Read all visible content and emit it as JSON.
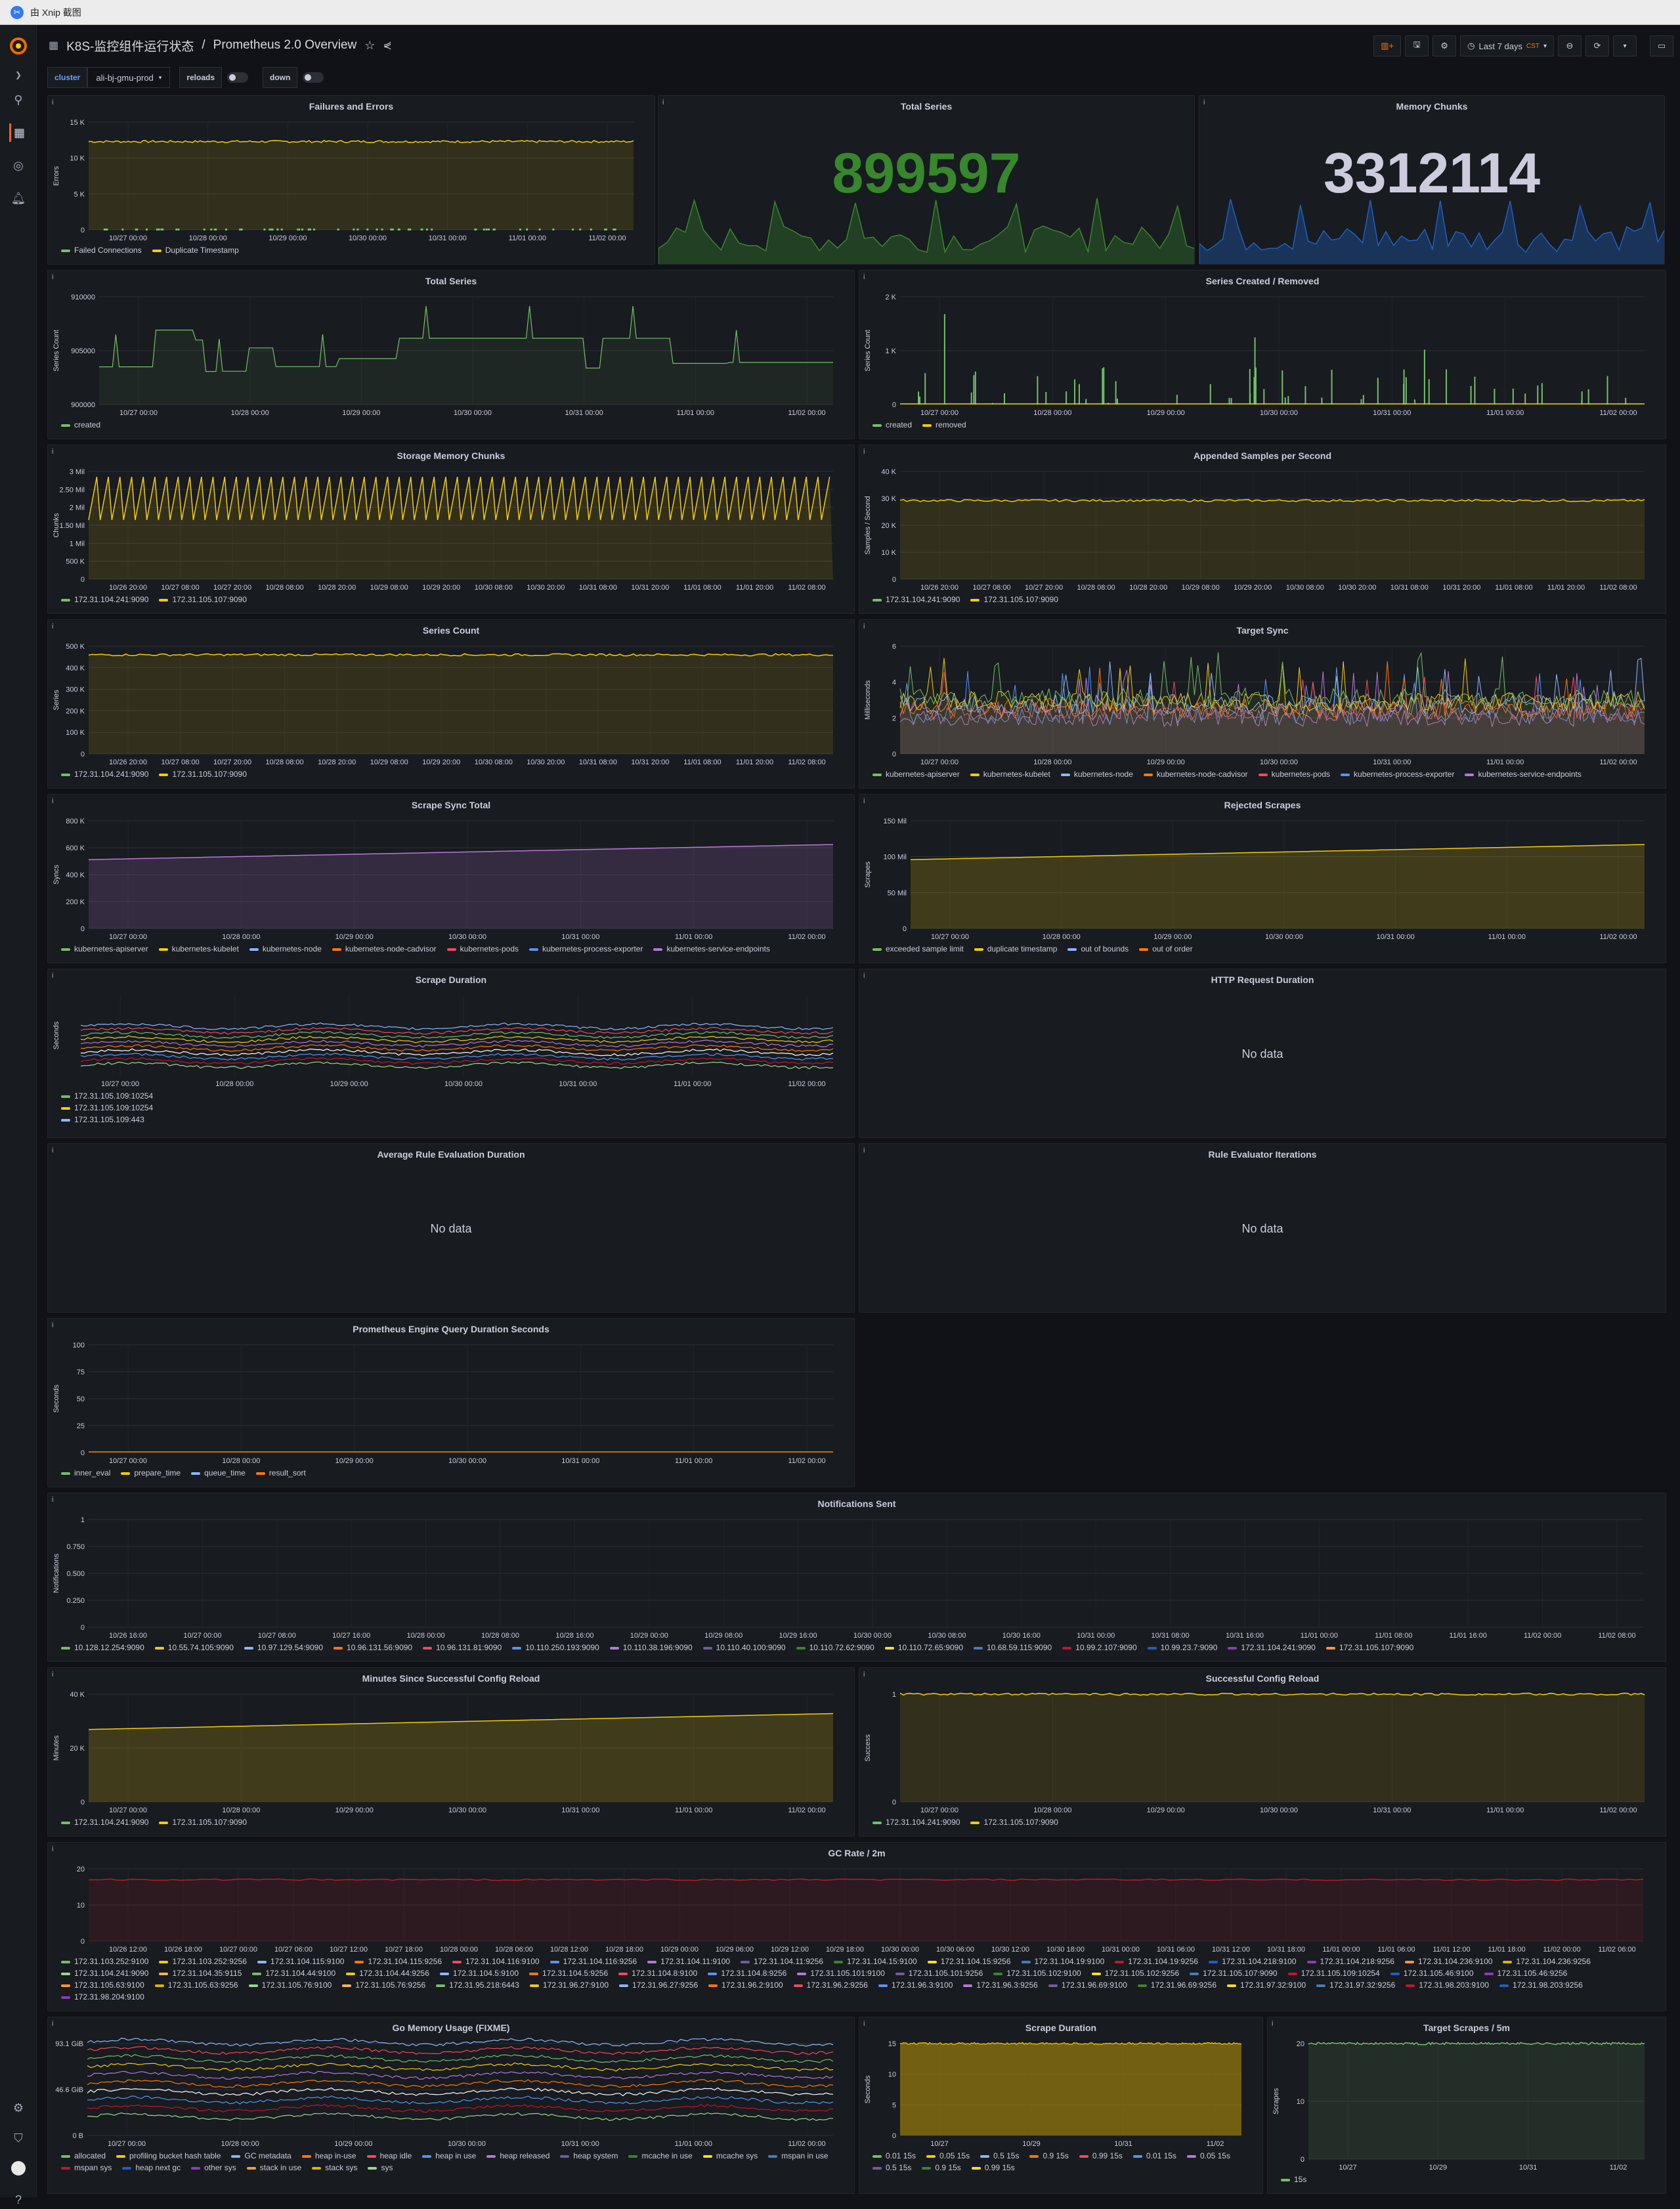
{
  "window": {
    "title": "由 Xnip 截图"
  },
  "header": {
    "folder": "K8S-监控组件运行状态",
    "separator": "/",
    "dashboard": "Prometheus 2.0 Overview",
    "time_range": "Last 7 days",
    "timezone": "CST"
  },
  "variables": [
    {
      "label": "cluster",
      "value": "ali-bj-gmu-prod",
      "type": "select"
    },
    {
      "label": "reloads",
      "type": "toggle"
    },
    {
      "label": "down",
      "type": "toggle"
    }
  ],
  "panels": {
    "failures": {
      "title": "Failures and Errors",
      "ylabel": "Errors",
      "yticks": [
        "15 K",
        "10 K",
        "5 K",
        "0"
      ],
      "xticks": [
        "10/27 00:00",
        "10/28 00:00",
        "10/29 00:00",
        "10/30 00:00",
        "10/31 00:00",
        "11/01 00:00",
        "11/02 00:00"
      ],
      "legend": [
        "Failed Connections",
        "Duplicate Timestamp"
      ]
    },
    "total_series_stat": {
      "title": "Total Series",
      "value": "899597",
      "color": "#37872d"
    },
    "memory_chunks_stat": {
      "title": "Memory Chunks",
      "value": "3312114",
      "color": "#ccccdc"
    },
    "total_series": {
      "title": "Total Series",
      "ylabel": "Series Count",
      "yticks": [
        "910000",
        "905000",
        "900000"
      ],
      "xticks": [
        "10/27 00:00",
        "10/28 00:00",
        "10/29 00:00",
        "10/30 00:00",
        "10/31 00:00",
        "11/01 00:00",
        "11/02 00:00"
      ],
      "legend": [
        "created"
      ]
    },
    "series_created": {
      "title": "Series Created / Removed",
      "ylabel": "Series Count",
      "yticks": [
        "2 K",
        "1 K",
        "0"
      ],
      "xticks": [
        "10/27 00:00",
        "10/28 00:00",
        "10/29 00:00",
        "10/30 00:00",
        "10/31 00:00",
        "11/01 00:00",
        "11/02 00:00"
      ],
      "legend": [
        "created",
        "removed"
      ]
    },
    "storage_chunks": {
      "title": "Storage Memory Chunks",
      "ylabel": "Chunks",
      "yticks": [
        "3 Mil",
        "2.50 Mil",
        "2 Mil",
        "1.50 Mil",
        "1 Mil",
        "500 K",
        "0"
      ],
      "xticks": [
        "10/26 20:00",
        "10/27 08:00",
        "10/27 20:00",
        "10/28 08:00",
        "10/28 20:00",
        "10/29 08:00",
        "10/29 20:00",
        "10/30 08:00",
        "10/30 20:00",
        "10/31 08:00",
        "10/31 20:00",
        "11/01 08:00",
        "11/01 20:00",
        "11/02 08:00"
      ],
      "legend": [
        "172.31.104.241:9090",
        "172.31.105.107:9090"
      ]
    },
    "appended": {
      "title": "Appended Samples per Second",
      "ylabel": "Samples / Second",
      "yticks": [
        "40 K",
        "30 K",
        "20 K",
        "10 K",
        "0"
      ],
      "xticks": [
        "10/26 20:00",
        "10/27 08:00",
        "10/27 20:00",
        "10/28 08:00",
        "10/28 20:00",
        "10/29 08:00",
        "10/29 20:00",
        "10/30 08:00",
        "10/30 20:00",
        "10/31 08:00",
        "10/31 20:00",
        "11/01 08:00",
        "11/01 20:00",
        "11/02 08:00"
      ],
      "legend": [
        "172.31.104.241:9090",
        "172.31.105.107:9090"
      ]
    },
    "series_count": {
      "title": "Series Count",
      "ylabel": "Series",
      "yticks": [
        "500 K",
        "400 K",
        "300 K",
        "200 K",
        "100 K",
        "0"
      ],
      "xticks": [
        "10/26 20:00",
        "10/27 08:00",
        "10/27 20:00",
        "10/28 08:00",
        "10/28 20:00",
        "10/29 08:00",
        "10/29 20:00",
        "10/30 08:00",
        "10/30 20:00",
        "10/31 08:00",
        "10/31 20:00",
        "11/01 08:00",
        "11/01 20:00",
        "11/02 08:00"
      ],
      "legend": [
        "172.31.104.241:9090",
        "172.31.105.107:9090"
      ]
    },
    "target_sync": {
      "title": "Target Sync",
      "ylabel": "Milliseconds",
      "yticks": [
        "6",
        "4",
        "2",
        "0"
      ],
      "xticks": [
        "10/27 00:00",
        "10/28 00:00",
        "10/29 00:00",
        "10/30 00:00",
        "10/31 00:00",
        "11/01 00:00",
        "11/02 00:00"
      ],
      "legend": [
        "kubernetes-apiserver",
        "kubernetes-kubelet",
        "kubernetes-node",
        "kubernetes-node-cadvisor",
        "kubernetes-pods",
        "kubernetes-process-exporter",
        "kubernetes-service-endpoints"
      ]
    },
    "scrape_sync": {
      "title": "Scrape Sync Total",
      "ylabel": "Syncs",
      "yticks": [
        "800 K",
        "600 K",
        "400 K",
        "200 K",
        "0"
      ],
      "xticks": [
        "10/27 00:00",
        "10/28 00:00",
        "10/29 00:00",
        "10/30 00:00",
        "10/31 00:00",
        "11/01 00:00",
        "11/02 00:00"
      ],
      "legend": [
        "kubernetes-apiserver",
        "kubernetes-kubelet",
        "kubernetes-node",
        "kubernetes-node-cadvisor",
        "kubernetes-pods",
        "kubernetes-process-exporter",
        "kubernetes-service-endpoints"
      ]
    },
    "rejected": {
      "title": "Rejected Scrapes",
      "ylabel": "Scrapes",
      "yticks": [
        "150 Mil",
        "100 Mil",
        "50 Mil",
        "0"
      ],
      "xticks": [
        "10/27 00:00",
        "10/28 00:00",
        "10/29 00:00",
        "10/30 00:00",
        "10/31 00:00",
        "11/01 00:00",
        "11/02 00:00"
      ],
      "legend": [
        "exceeded sample limit",
        "duplicate timestamp",
        "out of bounds",
        "out of order"
      ]
    },
    "scrape_duration": {
      "title": "Scrape Duration",
      "ylabel": "Seconds",
      "xticks": [
        "10/27 00:00",
        "10/28 00:00",
        "10/29 00:00",
        "10/30 00:00",
        "10/31 00:00",
        "11/01 00:00",
        "11/02 00:00"
      ],
      "legend": [
        "172.31.105.109:10254",
        "172.31.105.109:10254",
        "172.31.105.109:443"
      ]
    },
    "http_duration": {
      "title": "HTTP Request Duration",
      "nodata": "No data"
    },
    "avg_rule": {
      "title": "Average Rule Evaluation Duration",
      "nodata": "No data"
    },
    "rule_iter": {
      "title": "Rule Evaluator Iterations",
      "nodata": "No data"
    },
    "engine_query": {
      "title": "Prometheus Engine Query Duration Seconds",
      "ylabel": "Seconds",
      "yticks": [
        "100",
        "75",
        "50",
        "25",
        "0"
      ],
      "xticks": [
        "10/27 00:00",
        "10/28 00:00",
        "10/29 00:00",
        "10/30 00:00",
        "10/31 00:00",
        "11/01 00:00",
        "11/02 00:00"
      ],
      "legend": [
        "inner_eval",
        "prepare_time",
        "queue_time",
        "result_sort"
      ]
    },
    "notifications": {
      "title": "Notifications Sent",
      "ylabel": "Notifications",
      "yticks": [
        "1",
        "0.750",
        "0.500",
        "0.250",
        "0"
      ],
      "xticks": [
        "10/26 16:00",
        "10/27 00:00",
        "10/27 08:00",
        "10/27 16:00",
        "10/28 00:00",
        "10/28 08:00",
        "10/28 16:00",
        "10/29 00:00",
        "10/29 08:00",
        "10/29 16:00",
        "10/30 00:00",
        "10/30 08:00",
        "10/30 16:00",
        "10/31 00:00",
        "10/31 08:00",
        "10/31 16:00",
        "11/01 00:00",
        "11/01 08:00",
        "11/01 16:00",
        "11/02 00:00",
        "11/02 08:00"
      ],
      "legend": [
        "10.128.12.254:9090",
        "10.55.74.105:9090",
        "10.97.129.54:9090",
        "10.96.131.56:9090",
        "10.96.131.81:9090",
        "10.110.250.193:9090",
        "10.110.38.196:9090",
        "10.110.40.100:9090",
        "10.110.72.62:9090",
        "10.110.72.65:9090",
        "10.68.59.115:9090",
        "10.99.2.107:9090",
        "10.99.23.7:9090",
        "172.31.104.241:9090",
        "172.31.105.107:9090"
      ]
    },
    "minutes_reload": {
      "title": "Minutes Since Successful Config Reload",
      "ylabel": "Minutes",
      "yticks": [
        "40 K",
        "20 K",
        "0"
      ],
      "xticks": [
        "10/27 00:00",
        "10/28 00:00",
        "10/29 00:00",
        "10/30 00:00",
        "10/31 00:00",
        "11/01 00:00",
        "11/02 00:00"
      ],
      "legend": [
        "172.31.104.241:9090",
        "172.31.105.107:9090"
      ]
    },
    "success_reload": {
      "title": "Successful Config Reload",
      "ylabel": "Success",
      "yticks": [
        "1",
        "0"
      ],
      "xticks": [
        "10/27 00:00",
        "10/28 00:00",
        "10/29 00:00",
        "10/30 00:00",
        "10/31 00:00",
        "11/01 00:00",
        "11/02 00:00"
      ],
      "legend": [
        "172.31.104.241:9090",
        "172.31.105.107:9090"
      ]
    },
    "gc_rate": {
      "title": "GC Rate / 2m",
      "yticks": [
        "20",
        "10",
        "0"
      ],
      "xticks": [
        "10/26 12:00",
        "10/26 18:00",
        "10/27 00:00",
        "10/27 06:00",
        "10/27 12:00",
        "10/27 18:00",
        "10/28 00:00",
        "10/28 06:00",
        "10/28 12:00",
        "10/28 18:00",
        "10/29 00:00",
        "10/29 06:00",
        "10/29 12:00",
        "10/29 18:00",
        "10/30 00:00",
        "10/30 06:00",
        "10/30 12:00",
        "10/30 18:00",
        "10/31 00:00",
        "10/31 06:00",
        "10/31 12:00",
        "10/31 18:00",
        "11/01 00:00",
        "11/01 06:00",
        "11/01 12:00",
        "11/01 18:00",
        "11/02 00:00",
        "11/02 06:00"
      ],
      "legend": [
        "172.31.103.252:9100",
        "172.31.103.252:9256",
        "172.31.104.115:9100",
        "172.31.104.115:9256",
        "172.31.104.116:9100",
        "172.31.104.116:9256",
        "172.31.104.11:9100",
        "172.31.104.11:9256",
        "172.31.104.15:9100",
        "172.31.104.15:9256",
        "172.31.104.19:9100",
        "172.31.104.19:9256",
        "172.31.104.218:9100",
        "172.31.104.218:9256",
        "172.31.104.236:9100",
        "172.31.104.236:9256",
        "172.31.104.241:9090",
        "172.31.104.35:9115",
        "172.31.104.44:9100",
        "172.31.104.44:9256",
        "172.31.104.5:9100",
        "172.31.104.5:9256",
        "172.31.104.8:9100",
        "172.31.104.8:9256",
        "172.31.105.101:9100",
        "172.31.105.101:9256",
        "172.31.105.102:9100",
        "172.31.105.102:9256",
        "172.31.105.107:9090",
        "172.31.105.109:10254",
        "172.31.105.46:9100",
        "172.31.105.46:9256",
        "172.31.105.63:9100",
        "172.31.105.63:9256",
        "172.31.105.76:9100",
        "172.31.105.76:9256",
        "172.31.95.218:6443",
        "172.31.96.27:9100",
        "172.31.96.27:9256",
        "172.31.96.2:9100",
        "172.31.96.2:9256",
        "172.31.96.3:9100",
        "172.31.96.3:9256",
        "172.31.96.69:9100",
        "172.31.96.69:9256",
        "172.31.97.32:9100",
        "172.31.97.32:9256",
        "172.31.98.203:9100",
        "172.31.98.203:9256",
        "172.31.98.204:9100"
      ]
    },
    "go_memory": {
      "title": "Go Memory Usage (FIXME)",
      "yticks": [
        "93.1 GiB",
        "46.6 GiB",
        "0 B"
      ],
      "xticks": [
        "10/27 00:00",
        "10/28 00:00",
        "10/29 00:00",
        "10/30 00:00",
        "10/31 00:00",
        "11/01 00:00",
        "11/02 00:00"
      ],
      "legend": [
        "allocated",
        "profiling bucket hash table",
        "GC metadata",
        "heap in-use",
        "heap idle",
        "heap in use",
        "heap released",
        "heap system",
        "mcache in use",
        "mcache sys",
        "mspan in use",
        "mspan sys",
        "heap next gc",
        "other sys",
        "stack in use",
        "stack sys",
        "sys"
      ]
    },
    "scrape_duration2": {
      "title": "Scrape Duration",
      "ylabel": "Seconds",
      "yticks": [
        "15",
        "10",
        "5",
        "0"
      ],
      "xticks": [
        "10/27",
        "10/29",
        "10/31",
        "11/02"
      ],
      "legend": [
        "0.01 15s",
        "0.05 15s",
        "0.5 15s",
        "0.9 15s",
        "0.99 15s",
        "0.01 15s",
        "0.05 15s",
        "0.5 15s",
        "0.9 15s",
        "0.99 15s"
      ]
    },
    "target_scrapes": {
      "title": "Target Scrapes / 5m",
      "ylabel": "Scrapes",
      "yticks": [
        "20",
        "10",
        "0"
      ],
      "xticks": [
        "10/27",
        "10/29",
        "10/31",
        "11/02"
      ],
      "legend": [
        "15s"
      ]
    }
  },
  "palette": [
    "#73bf69",
    "#f2cc0c",
    "#8ab8ff",
    "#ff780a",
    "#f2495c",
    "#5794f2",
    "#b877d9",
    "#705da0",
    "#37872d",
    "#fade2a",
    "#447ebc",
    "#c4162a",
    "#1f60c4",
    "#8f3bb8",
    "#ff9830",
    "#e0b400",
    "#96d98d",
    "#ffb357"
  ]
}
